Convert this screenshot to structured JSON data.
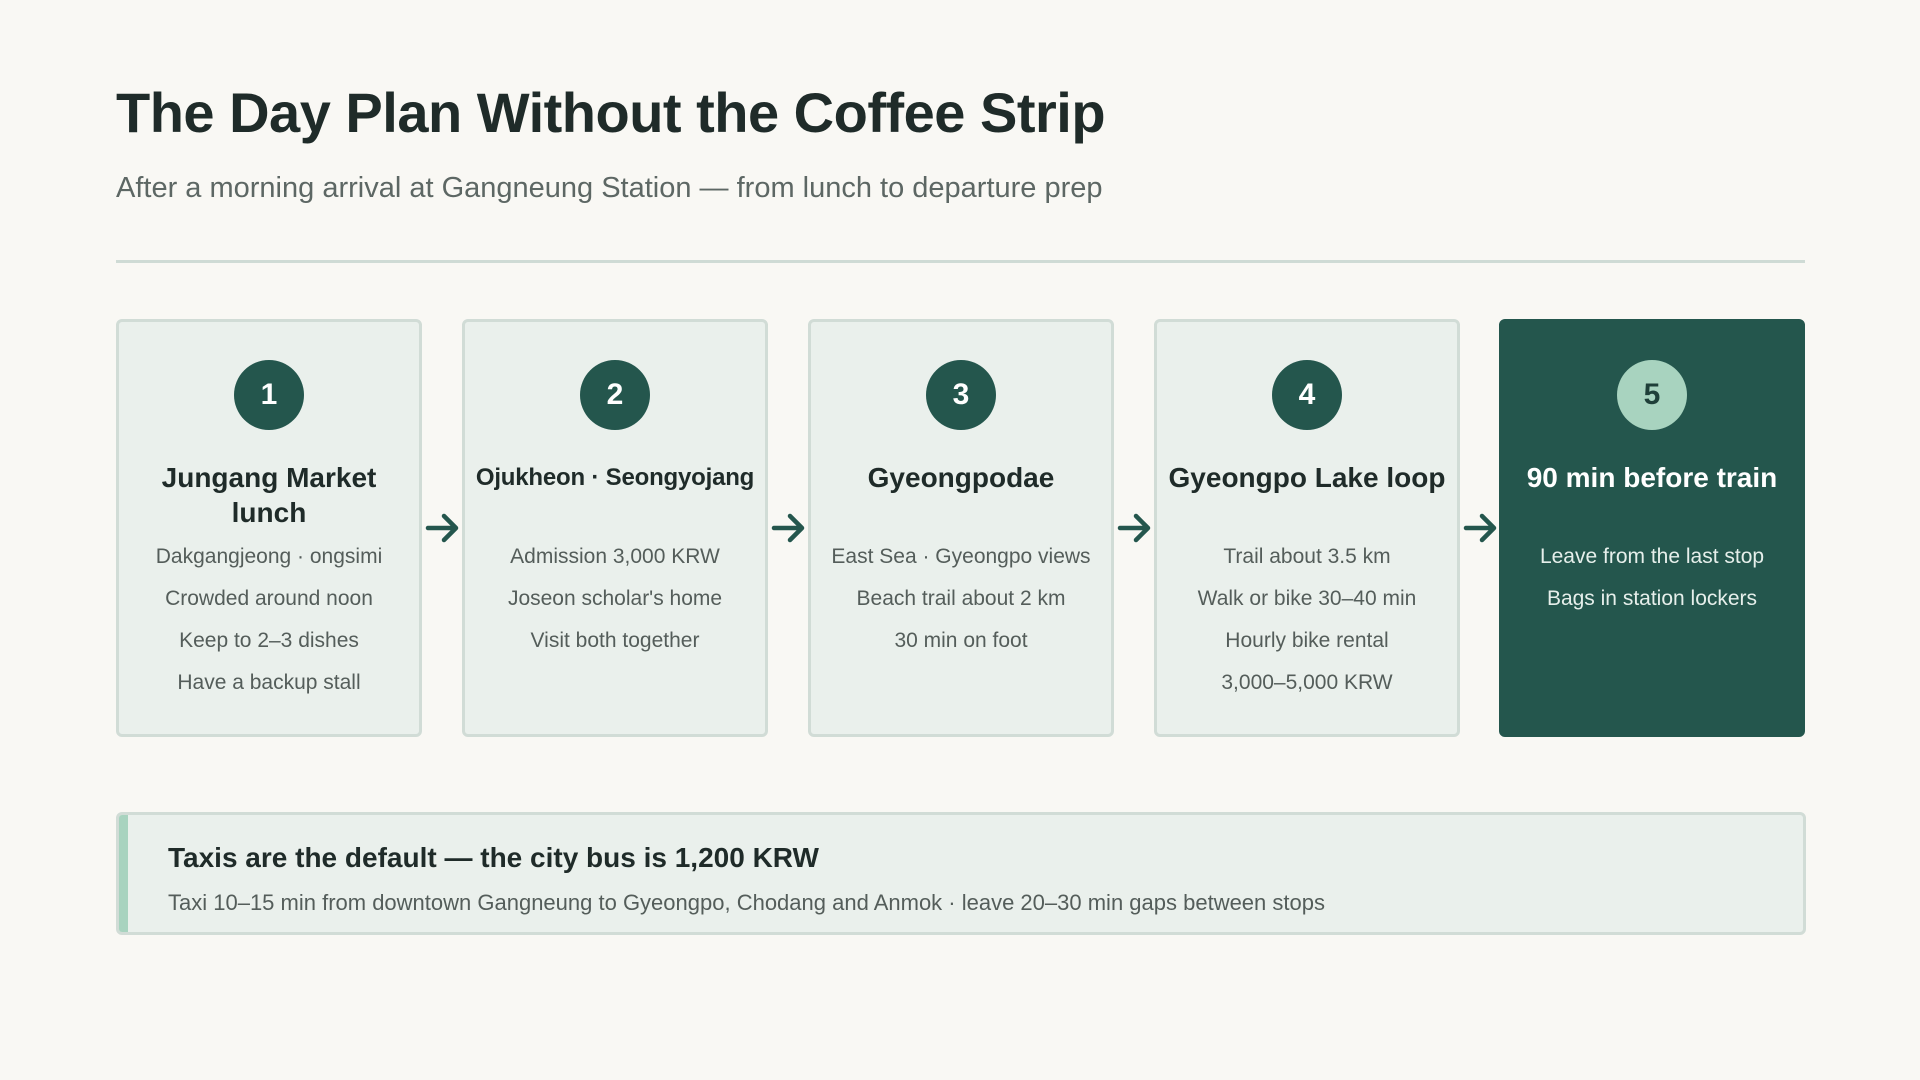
{
  "header": {
    "title": "The Day Plan Without the Coffee Strip",
    "subtitle": "After a morning arrival at Gangneung Station — from lunch to departure prep"
  },
  "steps": [
    {
      "number": "1",
      "title": "Jungang Market lunch",
      "lines": [
        "Dakgangjeong · ongsimi",
        "Crowded around noon",
        "Keep to 2–3 dishes",
        "Have a backup stall"
      ]
    },
    {
      "number": "2",
      "title": "Ojukheon · Seongyojang",
      "lines": [
        "Admission 3,000 KRW",
        "Joseon scholar's home",
        "Visit both together"
      ]
    },
    {
      "number": "3",
      "title": "Gyeongpodae",
      "lines": [
        "East Sea · Gyeongpo views",
        "Beach trail about 2 km",
        "30 min on foot"
      ]
    },
    {
      "number": "4",
      "title": "Gyeongpo Lake loop",
      "lines": [
        "Trail about 3.5 km",
        "Walk or bike 30–40 min",
        "Hourly bike rental",
        "3,000–5,000 KRW"
      ]
    },
    {
      "number": "5",
      "title": "90 min before train",
      "lines": [
        "Leave from the last stop",
        "Bags in station lockers"
      ]
    }
  ],
  "note": {
    "title": "Taxis are the default — the city bus is 1,200 KRW",
    "text": "Taxi 10–15 min from downtown Gangneung to Gyeongpo, Chodang and Anmok · leave 20–30 min gaps between stops"
  },
  "colors": {
    "background": "#f9f8f4",
    "accent": "#24564d",
    "card_fill": "#eaf0ec",
    "highlight": "#a8d3bf"
  }
}
